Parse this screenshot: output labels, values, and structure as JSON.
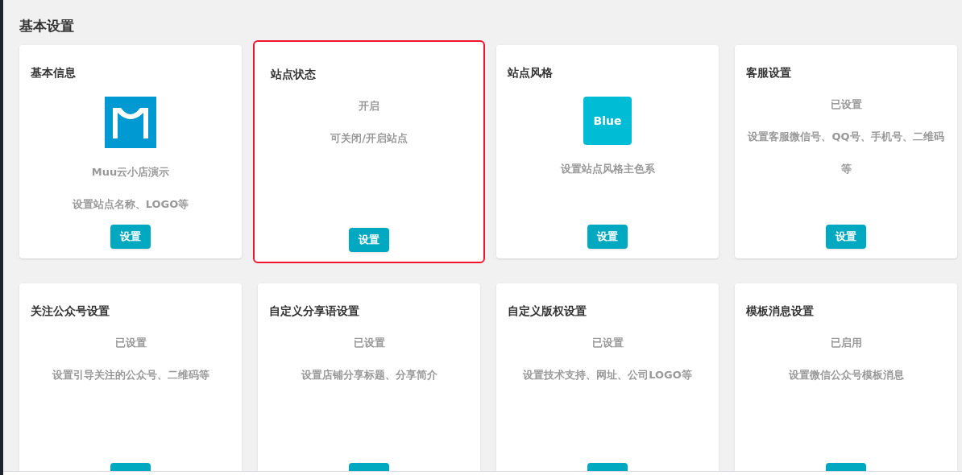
{
  "section_title": "基本设置",
  "cards": [
    {
      "title": "基本信息",
      "selected": false,
      "logo": {
        "kind": "m"
      },
      "lines": [
        "Muu云小店演示",
        "设置站点名称、LOGO等"
      ],
      "button": "设置"
    },
    {
      "title": "站点状态",
      "selected": true,
      "lines": [
        "开启",
        "可关闭/开启站点"
      ],
      "button": "设置"
    },
    {
      "title": "站点风格",
      "selected": false,
      "logo": {
        "kind": "swatch",
        "label": "Blue"
      },
      "lines": [
        "设置站点风格主色系"
      ],
      "button": "设置"
    },
    {
      "title": "客服设置",
      "selected": false,
      "lines": [
        "已设置",
        "设置客服微信号、QQ号、手机号、二维码等"
      ],
      "button": "设置"
    },
    {
      "title": "关注公众号设置",
      "selected": false,
      "lines": [
        "已设置",
        "设置引导关注的公众号、二维码等"
      ]
    },
    {
      "title": "自定义分享语设置",
      "selected": false,
      "lines": [
        "已设置",
        "设置店铺分享标题、分享简介"
      ]
    },
    {
      "title": "自定义版权设置",
      "selected": false,
      "lines": [
        "已设置",
        "设置技术支持、网址、公司LOGO等"
      ]
    },
    {
      "title": "模板消息设置",
      "selected": false,
      "lines": [
        "已启用",
        "设置微信公众号模板消息"
      ]
    }
  ]
}
